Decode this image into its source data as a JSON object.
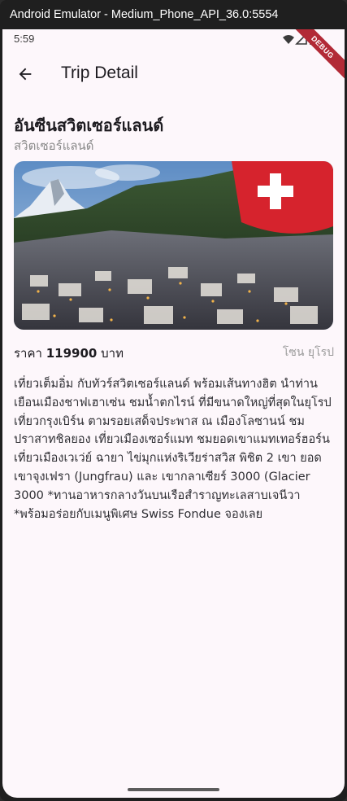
{
  "window": {
    "title": "Android Emulator - Medium_Phone_API_36.0:5554"
  },
  "status_bar": {
    "time": "5:59",
    "debug_banner": "DEBUG"
  },
  "app_bar": {
    "title": "Trip Detail",
    "back_icon": "arrow-back-icon"
  },
  "trip": {
    "title": "อันซีนสวิตเซอร์แลนด์",
    "country": "สวิตเซอร์แลนด์",
    "price_label": "ราคา",
    "price_value": "119900",
    "price_unit": "บาท",
    "zone": "โซน ยุโรป",
    "description": "เที่ยวเต็มอิ่ม กับทัวร์สวิตเซอร์แลนด์ พร้อมเส้นทางฮิต นำท่านเยือนเมืองชาฟเฮาเซ่น ชมน้ำตกไรน์ ที่มีขนาดใหญ่ที่สุดในยุโรป เที่ยวกรุงเบิร์น ตามรอยเสด็จประพาส ณ เมืองโลซานน์ ชมปราสาทชิลยอง เที่ยวเมืองเซอร์แมท ชมยอดเขาแมทเทอร์ฮอร์น เที่ยวเมืองเวเว่ย์ ฉายา ไข่มุกแห่งริเวียร่าสวิส พิชิต 2 เขา ยอดเขาจุงเฟรา (Jungfrau) และ เขากลาเซียร์ 3000 (Glacier 3000 *ทานอาหารกลางวันบนเรือสำราญทะเลสาบเจนีวา *พร้อมอร่อยกับเมนูพิเศษ Swiss Fondue จองเลย"
  },
  "icons": [
    "wifi-icon",
    "signal-icon",
    "battery-icon",
    "arrow-back-icon"
  ]
}
